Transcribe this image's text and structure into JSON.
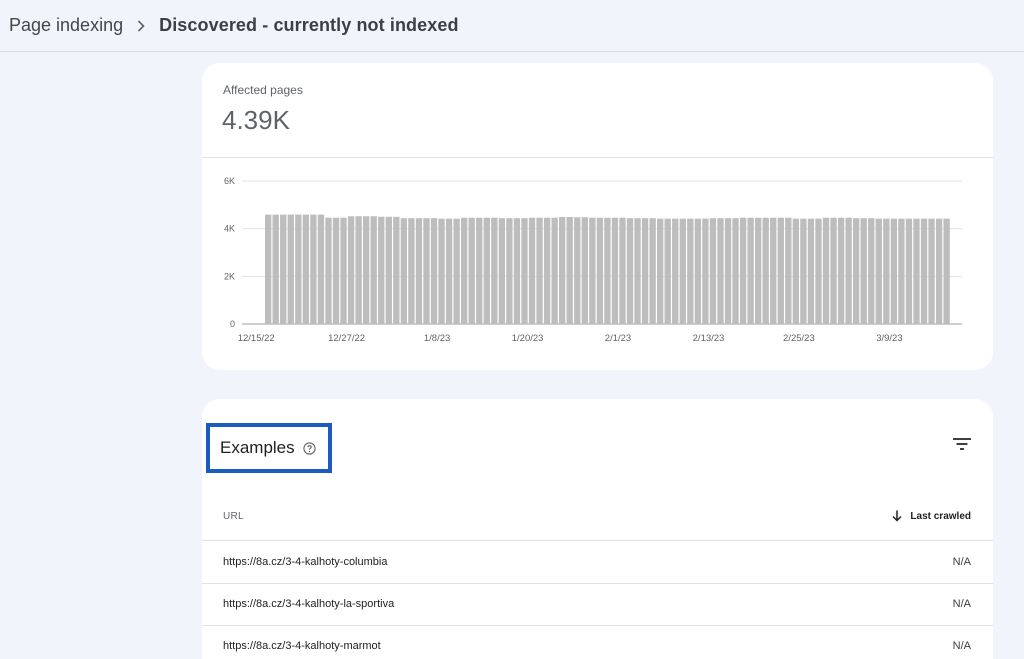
{
  "breadcrumb": {
    "parent": "Page indexing",
    "current": "Discovered - currently not indexed"
  },
  "summary": {
    "label": "Affected pages",
    "value": "4.39K"
  },
  "chart_data": {
    "type": "bar",
    "ylim": [
      0,
      6000
    ],
    "yticks": [
      "0",
      "2K",
      "4K",
      "6K"
    ],
    "ytick_values": [
      0,
      2000,
      4000,
      6000
    ],
    "xticks": [
      "12/15/22",
      "12/27/22",
      "1/8/23",
      "1/20/23",
      "2/1/23",
      "2/13/23",
      "2/25/23",
      "3/9/23"
    ],
    "grid": true,
    "bar_color": "#bdbdbd",
    "values": [
      4590,
      4590,
      4590,
      4590,
      4590,
      4590,
      4590,
      4590,
      4460,
      4460,
      4460,
      4520,
      4520,
      4520,
      4520,
      4500,
      4500,
      4500,
      4440,
      4440,
      4440,
      4440,
      4440,
      4420,
      4420,
      4420,
      4460,
      4460,
      4460,
      4460,
      4460,
      4440,
      4440,
      4440,
      4440,
      4460,
      4460,
      4460,
      4460,
      4490,
      4490,
      4480,
      4480,
      4460,
      4460,
      4460,
      4460,
      4460,
      4440,
      4440,
      4440,
      4440,
      4420,
      4420,
      4420,
      4420,
      4420,
      4420,
      4420,
      4440,
      4440,
      4440,
      4440,
      4460,
      4460,
      4460,
      4460,
      4460,
      4460,
      4460,
      4420,
      4420,
      4420,
      4420,
      4460,
      4460,
      4460,
      4460,
      4440,
      4440,
      4440,
      4420,
      4420,
      4420,
      4420,
      4420,
      4420,
      4420,
      4420,
      4420,
      4420
    ]
  },
  "examples": {
    "title": "Examples",
    "columns": {
      "url": "URL",
      "last_crawled": "Last crawled"
    },
    "rows": [
      {
        "url": "https://8a.cz/3-4-kalhoty-columbia",
        "last_crawled": "N/A"
      },
      {
        "url": "https://8a.cz/3-4-kalhoty-la-sportiva",
        "last_crawled": "N/A"
      },
      {
        "url": "https://8a.cz/3-4-kalhoty-marmot",
        "last_crawled": "N/A"
      }
    ]
  },
  "icons": {
    "breadcrumb_separator": "chevron-right-icon",
    "help": "help-circle-icon",
    "filter": "filter-icon",
    "sort": "arrow-down-icon"
  },
  "colors": {
    "highlight_border": "#1a5cc0",
    "page_background": "#f1f4fb"
  }
}
